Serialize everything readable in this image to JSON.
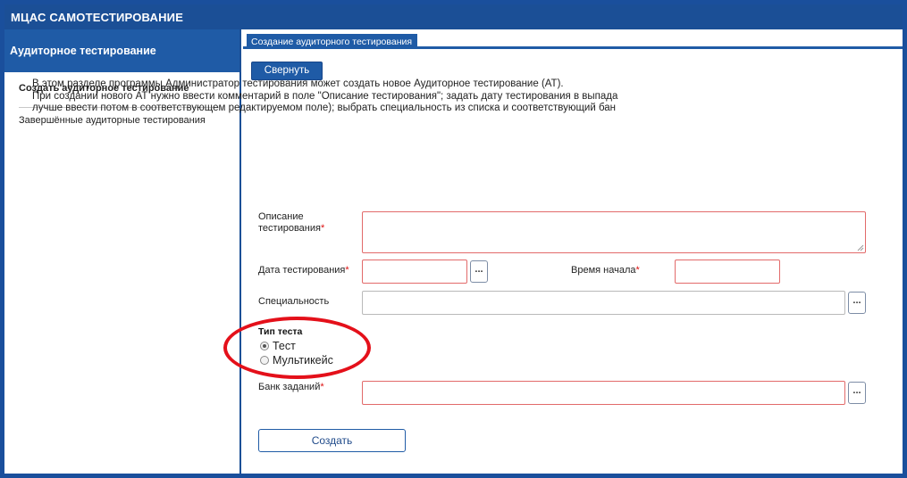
{
  "app": {
    "title": "МЦАС САМОТЕСТИРОВАНИЕ"
  },
  "sidebar": {
    "header": "Аудиторное тестирование",
    "items": [
      {
        "label": "Создать аудиторное тестирование",
        "active": true
      },
      {
        "label": "Завершённые аудиторные тестирования",
        "active": false
      }
    ]
  },
  "main": {
    "tab_label": "Создание аудиторного тестирования",
    "collapse_label": "Свернуть",
    "intro": [
      "В этом разделе программы Администратор тестирования может создать новое Аудиторное тестирование (АТ).",
      "При создании нового АТ нужно ввести комментарий в поле \"Описание тестирования\"; задать дату тестирования в выпада",
      "лучше ввести потом в соответствующем редактируемом поле); выбрать специальность из списка и соответствующий бан"
    ]
  },
  "form": {
    "description_label_line1": "Описание",
    "description_label_line2": "тестирования",
    "description_value": "",
    "date_label": "Дата тестирования",
    "date_value": "",
    "start_time_label": "Время начала",
    "start_time_value": "",
    "specialty_label": "Специальность",
    "specialty_value": "",
    "test_type_label": "Тип теста",
    "test_type_options": [
      {
        "label": "Тест",
        "selected": true
      },
      {
        "label": "Мультикейс",
        "selected": false
      }
    ],
    "bank_label": "Банк заданий",
    "bank_value": "",
    "required_mark": "*",
    "picker_button_label": "...",
    "create_label": "Создать"
  },
  "colors": {
    "primary": "#1f5ba6",
    "required_border": "#e26a6a",
    "annotation": "#e4101a"
  }
}
